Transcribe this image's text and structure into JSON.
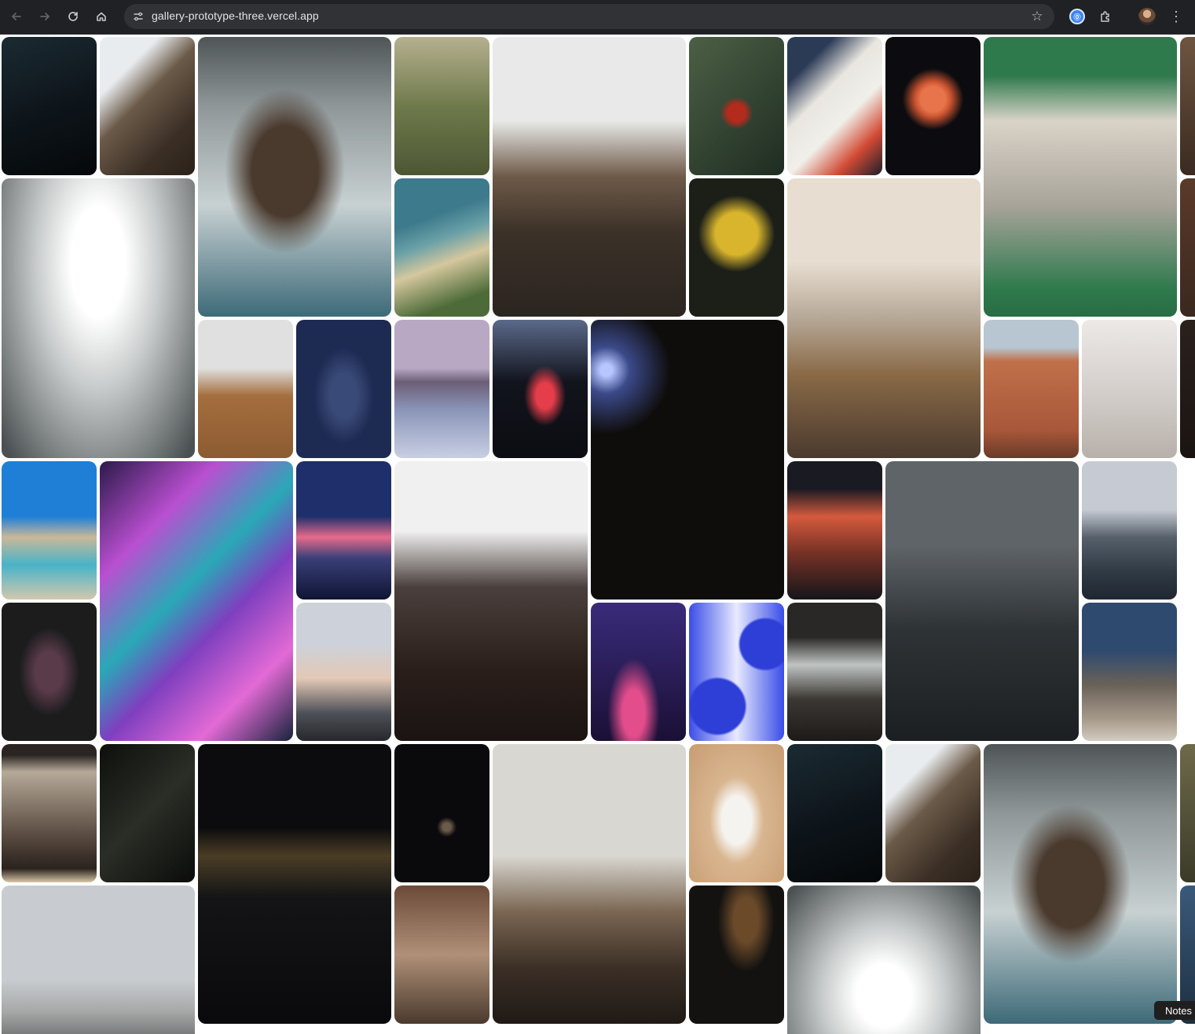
{
  "browser": {
    "url": "gallery-prototype-three.vercel.app",
    "password_manager_glyph": "⓪",
    "icons": [
      "back-icon",
      "forward-icon",
      "reload-icon",
      "home-icon",
      "site-settings-icon",
      "bookmark-star-icon",
      "password-manager-icon",
      "extensions-icon",
      "profile-avatar",
      "kebab-menu-icon"
    ]
  },
  "gallery": {
    "tiles": [
      {
        "name": "night-sky-stars",
        "bg": "linear-gradient(160deg,#1b2a33,#0d1419 55%,#05080a)"
      },
      {
        "name": "home-office-desk",
        "bg": "linear-gradient(135deg,#e9ecef 0 25%,#6b5a48 45%,#3b2f25 75%,#2a211a)"
      },
      {
        "name": "sea-cliff-island",
        "bg": "radial-gradient(ellipse at 45% 48%,#4a3a2e 0 22%,transparent 40%),linear-gradient(180deg,#4f5556 0%,#8f9798 25%,#c8d1d2 60%,#3d6a78 100%)"
      },
      {
        "name": "camera-tripod-hills",
        "bg": "linear-gradient(180deg,#b5b08f,#6f7a4b 50%,#4d5634)"
      },
      {
        "name": "amsterdam-canal-houseboat",
        "bg": "linear-gradient(180deg,#e8e9e8 0 30%,#6e5a48 50%,#3b3128 70%,#2b2520)"
      },
      {
        "name": "holly-berries",
        "bg": "radial-gradient(circle at 50% 55%,#b32b1c 0 10%,transparent 18%),linear-gradient(135deg,#4c6045,#1f2c22)"
      },
      {
        "name": "sticker-skateboard",
        "bg": "linear-gradient(135deg,#2b3a55 0 20%,#e9e6e0 40%,#f0efe9 60%,#d24a34 80%,#1a1e2a)"
      },
      {
        "name": "jellyfish-dark",
        "bg": "radial-gradient(circle at 50% 45%,#e8744c 0 14%,#c8532f 20%,transparent 34%),#0c0c10"
      },
      {
        "name": "ice-cream-truck",
        "bg": "linear-gradient(180deg,#2f7a4d 0 14%,#d9d3c8 30%,#a9a49a 60%,#2f7a4d 90%,#286c43)"
      },
      {
        "name": "edge-tile-top",
        "bg": "linear-gradient(180deg,#6e5541,#3a2a20)"
      },
      {
        "name": "green-sports-car",
        "bg": "radial-gradient(ellipse at 50% 30%,#ffffff 0 20%,#c9cccc 45%,#4b5152 95%)"
      },
      {
        "name": "coastal-beach",
        "bg": "linear-gradient(160deg,#3d7a8c 0 30%,#6ba1a8 45%,#d5c79e 60%,#4d6b38 85%)"
      },
      {
        "name": "yellow-flowers",
        "bg": "radial-gradient(circle at 50% 40%,#d9b52d 0 22%,transparent 40%),#1b1f18"
      },
      {
        "name": "woman-overlooking-boats",
        "bg": "linear-gradient(180deg,#e7ddd0 0 30%,#b6a897 50%,#8a6a47 70%,#4a3a2e)"
      },
      {
        "name": "edge-tile-middle",
        "bg": "linear-gradient(180deg,#5a3a2a,#3a281e)"
      },
      {
        "name": "mac-studio-desk",
        "bg": "linear-gradient(180deg,#e0e0e0 0 35%,#a46e3e 55%,#8c5b31)"
      },
      {
        "name": "woman-kneeling-blue",
        "bg": "radial-gradient(ellipse at 50% 55%,#3a4a78 0 20%,transparent 45%),#1d2a52"
      },
      {
        "name": "mountains-above-clouds",
        "bg": "linear-gradient(180deg,#b8a8c3 0 35%,#6c5e77 45%,#8a95b8 65%,#c9cfe3)"
      },
      {
        "name": "red-neon-light",
        "bg": "radial-gradient(ellipse at 55% 55%,#e53d4a 0 12%,transparent 28%),linear-gradient(180deg,#5b6a8a,#12141d 45%,#0c0d12)"
      },
      {
        "name": "galaxy-night",
        "bg": "radial-gradient(circle at 8% 18%,#b7c6ff 0 2%,#3b4a8a 8%,transparent 22%),#0f0d0c"
      },
      {
        "name": "stockholm-building",
        "bg": "linear-gradient(180deg,#b7c6d1 0 20%,#c0704a 30%,#a8573a 80%,#6a3a28)"
      },
      {
        "name": "frosted-plants",
        "bg": "linear-gradient(180deg,#ede9e7,#cfcac6 60%,#b8b0aa)"
      },
      {
        "name": "edge-tile-lower",
        "bg": "linear-gradient(180deg,#2a211d,#1a1411)"
      },
      {
        "name": "man-red-umbrella",
        "bg": "linear-gradient(180deg,#1f7fd6 0 40%,#c9b89a 55%,#48b3c8 75%,#d2c8ae)"
      },
      {
        "name": "abstract-fluid-art",
        "bg": "linear-gradient(135deg,#2b1a4a 0%,#b94fd1 25%,#2aa8b8 45%,#7e3fbf 60%,#e36ad6 80%,#16243b)"
      },
      {
        "name": "sunset-ocean",
        "bg": "linear-gradient(180deg,#1f2f6b 0 40%,#e66b8c 55%,#3a3f78 70%,#0e1533)"
      },
      {
        "name": "dj-party",
        "bg": "linear-gradient(180deg,#f0f0f0 0 25%,#4a3f3c 45%,#2a1e1a 75%,#1a1412)"
      },
      {
        "name": "neon-tokyo-building",
        "bg": "linear-gradient(180deg,#1a1a22 0 20%,#d45a3e 40%,#7a3326 65%,#15151a)"
      },
      {
        "name": "foggy-forest-road",
        "bg": "linear-gradient(180deg,#5f6468 0 30%,#2e3336 60%,#1c1f21)"
      },
      {
        "name": "city-skyline-bridge",
        "bg": "linear-gradient(180deg,#c6cbd3 0 35%,#56606b 55%,#2f3a44 80%,#1f2730)"
      },
      {
        "name": "tulip-bouquet",
        "bg": "radial-gradient(ellipse at 50% 50%,#5a3b4a 0 20%,transparent 45%),#1c1c1d"
      },
      {
        "name": "beach-silhouette",
        "bg": "linear-gradient(180deg,#cdd2da 0 30%,#e3c8b6 55%,#4d5057 80%,#26282c)"
      },
      {
        "name": "dancer-purple-light",
        "bg": "radial-gradient(ellipse at 45% 80%,#e34d8c 0 15%,transparent 35%),linear-gradient(180deg,#3a2b7a,#1a1035)"
      },
      {
        "name": "blue-abstract-shapes",
        "bg": "radial-gradient(circle at 80% 30%,#2d3fd6 0 20%,transparent 22%),radial-gradient(circle at 30% 75%,#2d3fd6 0 22%,transparent 24%),linear-gradient(90deg,#3a4de8,#e8eaff 50%,#3a4de8)"
      },
      {
        "name": "cafe-window-interior",
        "bg": "linear-gradient(180deg,#2a2826 0 25%,#bfc4c3 45%,#3b3733 70%,#1d1b19)"
      },
      {
        "name": "street-crossing-city",
        "bg": "linear-gradient(180deg,#2f4a6f 0 35%,#6b6258 60%,#a89c8c 85%,#d2ccc2)"
      },
      {
        "name": "kodak-portra-film",
        "bg": "linear-gradient(180deg,#2a2522 0 8%,#b5a998 20%,#5b4d42 65%,#2a221d 90%,#d9c6a8)"
      },
      {
        "name": "dark-silk-folds",
        "bg": "linear-gradient(135deg,#0d0f0c,#2a2e26 50%,#0b0c0a)"
      },
      {
        "name": "woman-dark-parking",
        "bg": "linear-gradient(180deg,#0c0c0e 0 30%,#4a3d25 40%,#141416 55%,#0a0a0c)"
      },
      {
        "name": "starry-galaxy",
        "bg": "radial-gradient(circle at 55% 60%,#6b5b4a 0 4%,transparent 10%),#0a0a0d"
      },
      {
        "name": "dog-by-window-piano",
        "bg": "linear-gradient(180deg,#d9d7d1 0 40%,#7a6652 60%,#3b2f26 80%,#1f1a16)"
      },
      {
        "name": "wedding-rings-box",
        "bg": "radial-gradient(ellipse at 50% 55%,#f5f3ef 0 22%,#d9b690 40%,#c79c72)"
      },
      {
        "name": "night-sky-stars-2",
        "bg": "linear-gradient(160deg,#1b2a33,#0d1419 55%,#05080a)"
      },
      {
        "name": "home-office-desk-2",
        "bg": "linear-gradient(135deg,#e9ecef 0 25%,#6b5a48 45%,#3b2f25 75%,#2a211a)"
      },
      {
        "name": "sea-cliff-island-2",
        "bg": "radial-gradient(ellipse at 45% 50%,#4a3a2e 0 22%,transparent 40%),linear-gradient(180deg,#4f5556 0%,#8f9798 25%,#c8d1d2 60%,#3d6a78 100%)"
      },
      {
        "name": "edge-tile-bottom",
        "bg": "linear-gradient(180deg,#6e6a4a,#3a3a28)"
      },
      {
        "name": "venice-dome",
        "bg": "linear-gradient(180deg,#c8ccd0 0 60%,#a7a8a8 80%,#6a6b6c)"
      },
      {
        "name": "amsterdam-facades",
        "bg": "linear-gradient(180deg,#6b4a38,#b09078 50%,#4a3a2e)"
      },
      {
        "name": "dim-restaurant",
        "bg": "radial-gradient(ellipse at 60% 25%,#6b4a2a 0 15%,transparent 35%),#141210"
      },
      {
        "name": "green-sports-car-2",
        "bg": "radial-gradient(ellipse at 50% 70%,#ffffff 0 20%,#c9cccc 45%,#4b5152 95%)"
      },
      {
        "name": "edge-tile-last",
        "bg": "linear-gradient(180deg,#3a5a7a,#1e2f40)"
      }
    ]
  },
  "notes_tooltip": "Notes"
}
